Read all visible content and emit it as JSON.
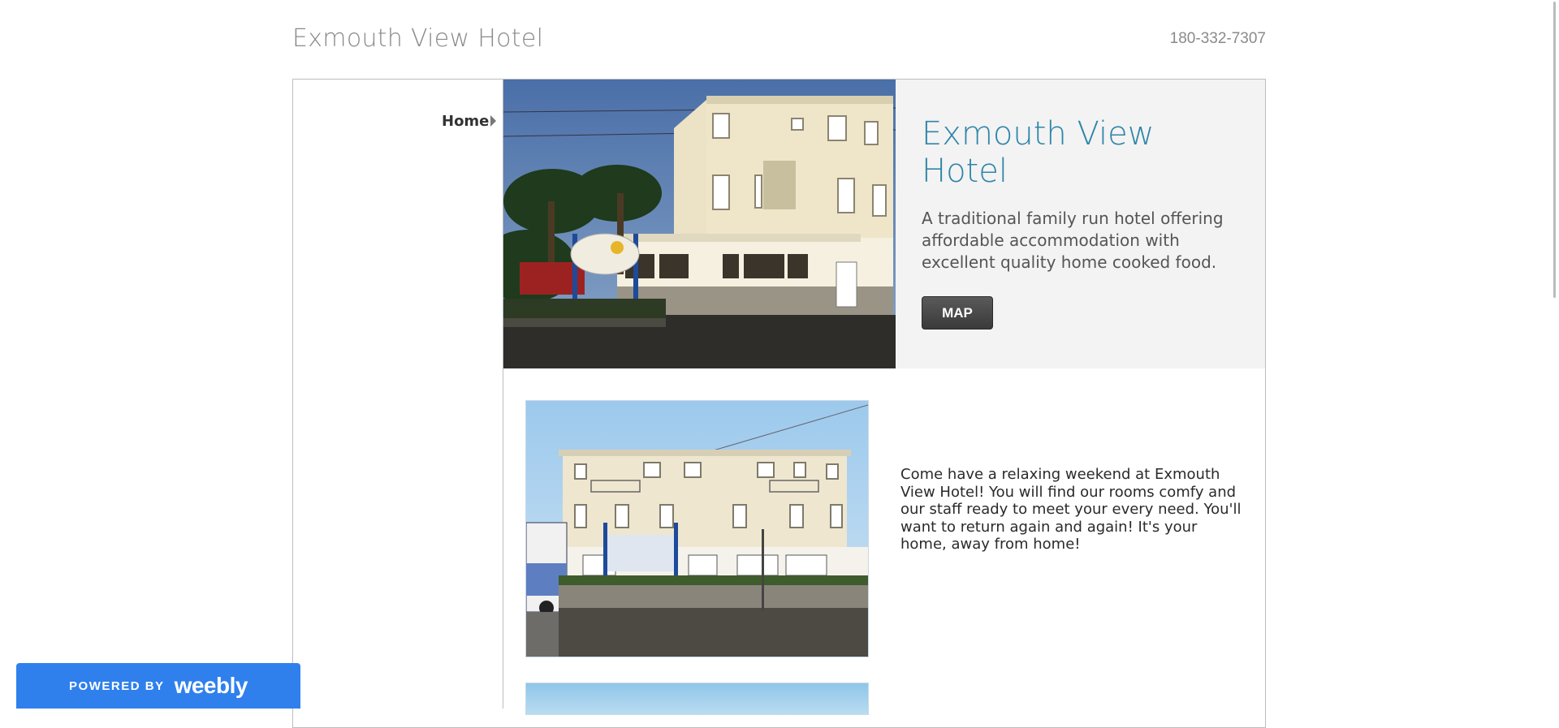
{
  "header": {
    "site_title": "Exmouth View Hotel",
    "phone": "180-332-7307"
  },
  "nav": {
    "items": [
      {
        "label": "Home"
      }
    ]
  },
  "hero": {
    "title": "Exmouth View Hotel",
    "description": "A traditional family run hotel offering affordable accommodation with excellent quality home cooked food.",
    "button_label": "MAP",
    "accent_color": "#2e86a8"
  },
  "main": {
    "intro_text": "Come have a relaxing weekend at Exmouth View Hotel! You will find our rooms comfy and our staff ready to meet your every need. You'll want to return again and again! It's your home, away from home!"
  },
  "footer_badge": {
    "powered_by": "POWERED BY",
    "brand": "weebly",
    "color": "#2f80ed"
  }
}
